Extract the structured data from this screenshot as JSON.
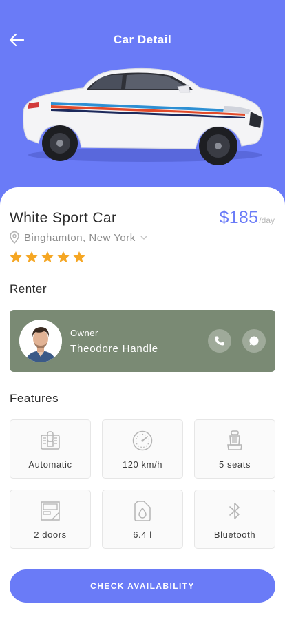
{
  "header": {
    "title": "Car Detail",
    "back_icon": "arrow-left-icon",
    "background_color": "#6a7bf7"
  },
  "car": {
    "name": "White Sport Car",
    "price": "$185",
    "price_unit": "/day",
    "location": "Binghamton, New York",
    "rating": 5,
    "rating_max": 5,
    "star_color": "#f5a623"
  },
  "renter": {
    "section_title": "Renter",
    "role": "Owner",
    "name": "Theodore Handle",
    "card_color": "#7a8a74",
    "actions": [
      {
        "icon": "phone-icon"
      },
      {
        "icon": "chat-icon"
      }
    ]
  },
  "features": {
    "section_title": "Features",
    "items": [
      {
        "icon": "gearbox-icon",
        "label": "Automatic"
      },
      {
        "icon": "speedometer-icon",
        "label": "120 km/h"
      },
      {
        "icon": "seat-icon",
        "label": "5 seats"
      },
      {
        "icon": "car-door-icon",
        "label": "2 doors"
      },
      {
        "icon": "fuel-icon",
        "label": "6.4 l"
      },
      {
        "icon": "bluetooth-icon",
        "label": "Bluetooth"
      }
    ]
  },
  "cta": {
    "label": "CHECK AVAILABILITY",
    "color": "#6a7bf7"
  }
}
